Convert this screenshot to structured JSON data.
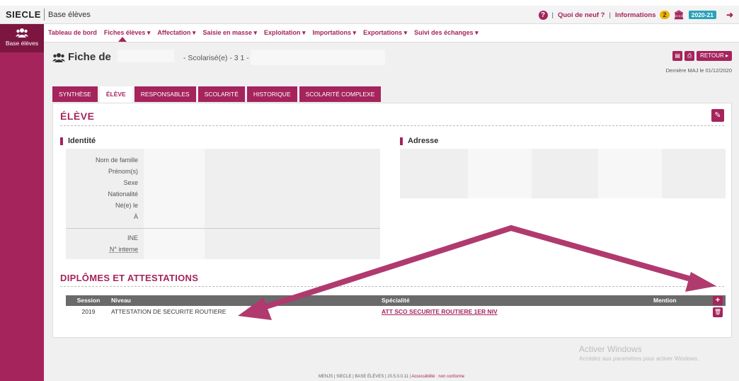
{
  "topbar": {
    "brand": "SIECLE",
    "module": "Base élèves",
    "whats_new": "Quoi de neuf ?",
    "informations": "Informations",
    "info_count": "2",
    "year": "2020-21"
  },
  "sidebar": {
    "item_label": "Base élèves"
  },
  "nav": {
    "items": [
      "Tableau de bord",
      "Fiches élèves ▾",
      "Affectation ▾",
      "Saisie en masse ▾",
      "Exploitation ▾",
      "Importations ▾",
      "Exportations ▾",
      "Suivi des échanges ▾"
    ]
  },
  "header": {
    "title": "Fiche de",
    "subtitle": "- Scolarisé(e) - 3 1 -",
    "retour": "RETOUR ▸",
    "last_update": "Dernière MAJ le 01/12/2020"
  },
  "tabs": [
    "SYNTHÈSE",
    "ÉLÈVE",
    "RESPONSABLES",
    "SCOLARITÉ",
    "HISTORIQUE",
    "SCOLARITÉ COMPLEXE"
  ],
  "eleve": {
    "section_title": "ÉLÈVE",
    "identite_title": "Identité",
    "adresse_title": "Adresse",
    "labels": [
      "Nom de famille",
      "Prénom(s)",
      "Sexe",
      "Nationalité",
      "Né(e) le",
      "À"
    ],
    "labels2": [
      "INE",
      "N° interne"
    ]
  },
  "diplomes": {
    "section_title": "DIPLÔMES ET ATTESTATIONS",
    "columns": {
      "session": "Session",
      "niveau": "Niveau",
      "specialite": "Spécialité",
      "mention": "Mention"
    },
    "rows": [
      {
        "session": "2019",
        "niveau": "ATTESTATION DE SECURITE ROUTIERE",
        "specialite": "ATT SCO SECURITE ROUTIERE 1ER NIV"
      }
    ]
  },
  "watermark": {
    "line1": "Activer Windows",
    "line2": "Accédez aux paramètres pour activer Windows."
  },
  "footer": {
    "text": "MENJS | SIECLE | BASE ÉLÈVES | 20.5.0.0.11 |",
    "accessibility": "Accessibilité : non conforme"
  },
  "colors": {
    "accent": "#a5245c",
    "arrow": "#b03a6e"
  }
}
